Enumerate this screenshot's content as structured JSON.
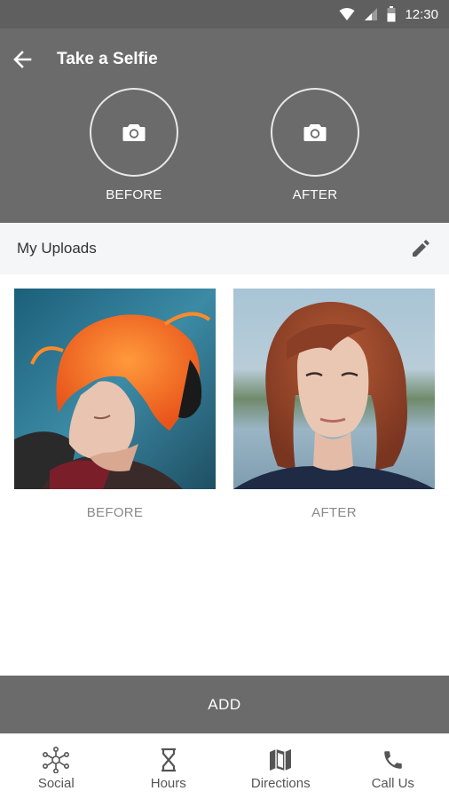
{
  "status_bar": {
    "time": "12:30"
  },
  "toolbar": {
    "title": "Take a Selfie"
  },
  "capture": {
    "before_label": "BEFORE",
    "after_label": "AFTER",
    "icon": "camera-icon"
  },
  "uploads": {
    "title": "My Uploads",
    "edit_icon": "pencil-icon",
    "photos": [
      {
        "caption": "BEFORE"
      },
      {
        "caption": "AFTER"
      }
    ]
  },
  "add_button": {
    "label": "ADD"
  },
  "bottom_nav": {
    "items": [
      {
        "label": "Social",
        "icon": "network-icon"
      },
      {
        "label": "Hours",
        "icon": "hourglass-icon"
      },
      {
        "label": "Directions",
        "icon": "map-icon"
      },
      {
        "label": "Call Us",
        "icon": "phone-icon"
      }
    ]
  },
  "colors": {
    "header": "#6b6b6b",
    "status_bar": "#5f5f5f",
    "uploads_bar": "#f5f6f7",
    "add_button": "#6b6b6b"
  }
}
